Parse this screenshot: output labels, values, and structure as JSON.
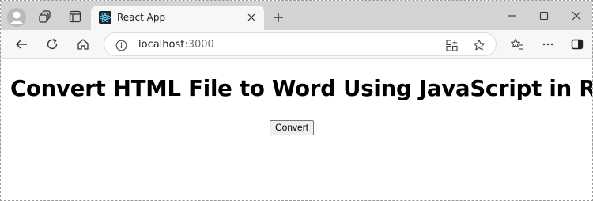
{
  "browser": {
    "tab": {
      "title": "React App"
    },
    "address": {
      "host": "localhost",
      "port": ":3000"
    },
    "icons": {
      "profile": "avatar-icon",
      "workspaces": "workspaces-icon",
      "tab_actions": "tab-actions-icon",
      "favicon": "react-logo-icon",
      "tab_close": "close-icon",
      "new_tab": "plus-icon",
      "minimize": "minimize-icon",
      "maximize": "maximize-icon",
      "window_close": "close-icon",
      "back": "back-arrow-icon",
      "refresh": "refresh-icon",
      "home": "home-icon",
      "site_info": "info-icon",
      "app_available": "app-icon",
      "favorite": "star-icon",
      "favorites": "favorites-icon",
      "more": "ellipsis-icon",
      "sidebar": "sidebar-icon"
    }
  },
  "page": {
    "title": "Convert HTML File to Word Using JavaScript in React",
    "convert_label": "Convert"
  }
}
